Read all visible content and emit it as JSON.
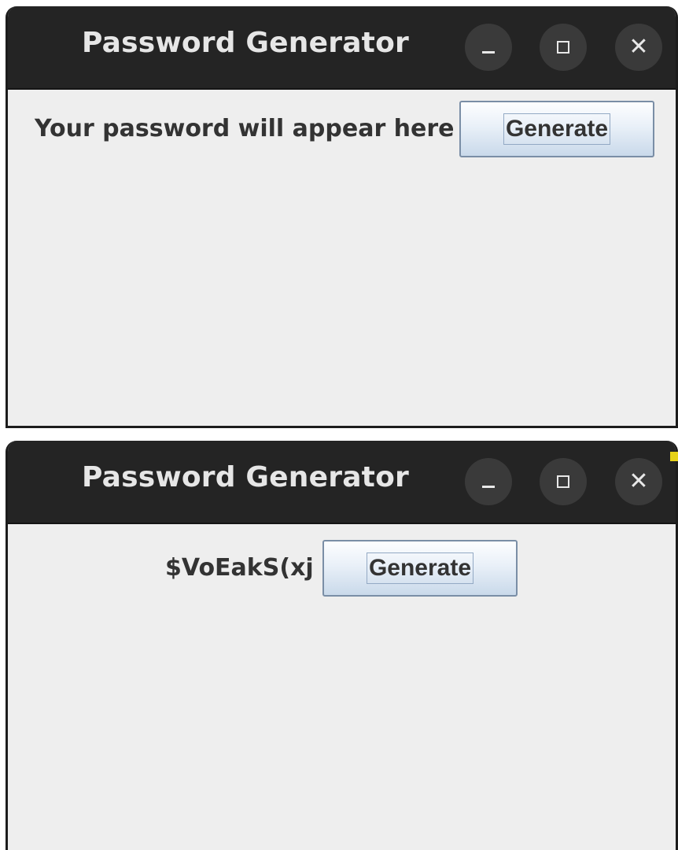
{
  "windows": [
    {
      "title": "Password Generator",
      "password_label": "Your password will appear here",
      "generate_label": "Generate"
    },
    {
      "title": "Password Generator",
      "password_label": "$VoEakS(xj",
      "generate_label": "Generate"
    }
  ],
  "controls": {
    "minimize_icon": "minimize-icon",
    "maximize_icon": "maximize-icon",
    "close_icon": "close-icon",
    "close_glyph": "✕"
  },
  "colors": {
    "titlebar": "#242424",
    "content": "#eeeeee",
    "button_border": "#7a8ea6"
  }
}
